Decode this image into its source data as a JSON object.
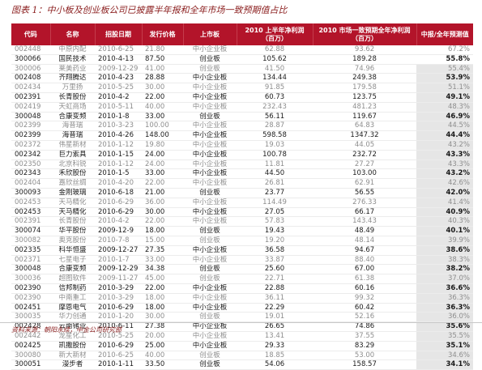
{
  "title": "图表 1：中小板及创业板公司已披露半年报和全年市场一致预期值占比",
  "source": "资料来源：朝阳永续，中金公司研究部",
  "table": {
    "headers": [
      "代码",
      "名称",
      "招股日期",
      "发行价格",
      "上市板",
      "2010 上半年净利润\n（百万）",
      "2010 市场一致预期全年净利润\n（百万）",
      "中报/全年预测值"
    ],
    "rows": [
      [
        "002448",
        "中原内配",
        "2010-6-25",
        "21.80",
        "中小企业板",
        "62.88",
        "93.62",
        "67.2%"
      ],
      [
        "300066",
        "国民技术",
        "2010-4-13",
        "87.50",
        "创业板",
        "105.62",
        "189.28",
        "55.8%"
      ],
      [
        "300006",
        "莱美药业",
        "2009-12-29",
        "41.00",
        "创业板",
        "41.50",
        "74.96",
        "55.4%"
      ],
      [
        "002408",
        "齐翔腾达",
        "2010-4-23",
        "28.88",
        "中小企业板",
        "134.44",
        "249.38",
        "53.9%"
      ],
      [
        "002434",
        "万里扬",
        "2010-5-25",
        "30.00",
        "中小企业板",
        "91.85",
        "179.58",
        "51.1%"
      ],
      [
        "002391",
        "长青股份",
        "2010-4-2",
        "22.00",
        "中小企业板",
        "60.73",
        "123.75",
        "49.1%"
      ],
      [
        "002419",
        "天虹商场",
        "2010-5-11",
        "40.00",
        "中小企业板",
        "232.43",
        "481.23",
        "48.3%"
      ],
      [
        "300048",
        "合康变频",
        "2010-1-8",
        "33.00",
        "创业板",
        "56.11",
        "119.67",
        "46.9%"
      ],
      [
        "002399",
        "海普瑞",
        "2010-3-23",
        "100.00",
        "中小企业板",
        "28.87",
        "64.83",
        "44.5%"
      ],
      [
        "002399",
        "海普瑞",
        "2010-4-26",
        "148.00",
        "中小企业板",
        "598.58",
        "1347.32",
        "44.4%"
      ],
      [
        "002372",
        "伟星新材",
        "2010-1-12",
        "19.80",
        "中小企业板",
        "19.03",
        "44.05",
        "43.2%"
      ],
      [
        "002342",
        "巨力索具",
        "2010-1-15",
        "24.00",
        "中小企业板",
        "100.78",
        "232.72",
        "43.3%"
      ],
      [
        "002350",
        "北京科锐",
        "2010-1-12",
        "24.00",
        "中小企业板",
        "11.81",
        "27.27",
        "43.3%"
      ],
      [
        "002343",
        "禾欣股份",
        "2010-1-5",
        "33.00",
        "中小企业板",
        "44.50",
        "103.00",
        "43.2%"
      ],
      [
        "002404",
        "嘉欣丝绸",
        "2010-4-20",
        "22.00",
        "中小企业板",
        "26.81",
        "62.91",
        "42.6%"
      ],
      [
        "300093",
        "金刚玻璃",
        "2010-6-18",
        "21.00",
        "创业板",
        "23.77",
        "56.55",
        "42.0%"
      ],
      [
        "002453",
        "天马精化",
        "2010-6-29",
        "36.00",
        "中小企业板",
        "114.49",
        "276.33",
        "41.4%"
      ],
      [
        "002453",
        "天马精化",
        "2010-6-29",
        "30.00",
        "中小企业板",
        "27.05",
        "66.17",
        "40.9%"
      ],
      [
        "002391",
        "长青股份",
        "2010-4-2",
        "22.00",
        "中小企业板",
        "57.83",
        "143.43",
        "40.3%"
      ],
      [
        "300074",
        "华平股份",
        "2009-12-9",
        "18.00",
        "创业板",
        "19.43",
        "48.49",
        "40.1%"
      ],
      [
        "300082",
        "奥克股份",
        "2010-7-8",
        "15.00",
        "创业板",
        "19.20",
        "48.14",
        "39.9%"
      ],
      [
        "002335",
        "科华恒盛",
        "2009-12-27",
        "27.35",
        "中小企业板",
        "36.58",
        "94.67",
        "38.6%"
      ],
      [
        "002371",
        "七星电子",
        "2010-1-7",
        "33.00",
        "中小企业板",
        "33.87",
        "88.40",
        "38.3%"
      ],
      [
        "300048",
        "合康变频",
        "2009-12-29",
        "34.38",
        "创业板",
        "25.60",
        "67.00",
        "38.2%"
      ],
      [
        "300036",
        "超图软件",
        "2009-11-27",
        "45.00",
        "创业板",
        "22.71",
        "61.38",
        "37.0%"
      ],
      [
        "002390",
        "信邦制药",
        "2010-3-29",
        "22.00",
        "中小企业板",
        "22.88",
        "60.16",
        "36.6%"
      ],
      [
        "002390",
        "中南重工",
        "2010-3-29",
        "18.00",
        "中小企业板",
        "36.11",
        "99.32",
        "36.3%"
      ],
      [
        "002451",
        "摩恩电气",
        "2010-6-29",
        "18.00",
        "中小企业板",
        "22.29",
        "60.42",
        "36.3%"
      ],
      [
        "300035",
        "华力创通",
        "2010-1-20",
        "30.00",
        "创业板",
        "19.01",
        "52.16",
        "36.0%"
      ],
      [
        "002428",
        "云南锗业",
        "2010-6-11",
        "27.38",
        "中小企业板",
        "26.65",
        "74.86",
        "35.6%"
      ],
      [
        "002442",
        "龙星化工",
        "2010-5-25",
        "20.00",
        "中小企业板",
        "13.41",
        "37.55",
        "35.5%"
      ],
      [
        "002425",
        "凯撒股份",
        "2010-6-29",
        "25.00",
        "中小企业板",
        "29.33",
        "83.29",
        "35.1%"
      ],
      [
        "300080",
        "新大新材",
        "2010-6-25",
        "40.00",
        "创业板",
        "18.85",
        "53.00",
        "34.6%"
      ],
      [
        "300051",
        "漫步者",
        "2010-1-11",
        "33.50",
        "创业板",
        "54.06",
        "158.57",
        "34.1%"
      ]
    ]
  },
  "colors": {
    "header_bg": "#b3142a",
    "title": "#8b1e1e",
    "shade": "#e6e6e6"
  }
}
